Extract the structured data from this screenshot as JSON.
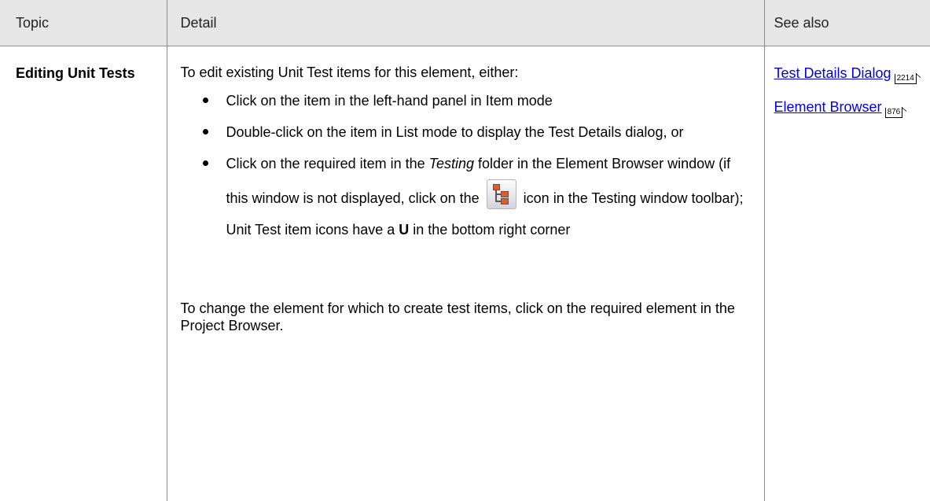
{
  "header": {
    "topic": "Topic",
    "detail": "Detail",
    "see_also": "See also"
  },
  "row": {
    "topic": "Editing Unit Tests",
    "intro": "To edit existing Unit Test items for this element, either:",
    "bullets": [
      "Click on the item in the left-hand panel in Item mode",
      "Double-click on the item in List mode to display the Test Details dialog, or"
    ],
    "bullet3": {
      "part1": "Click on the required item in the ",
      "italic": "Testing",
      "part2": " folder in the Element Browser window (if this window is not displayed, click on the ",
      "part3": " icon in the Testing window toolbar); Unit Test item icons have a ",
      "bold": "U",
      "part4": " in the bottom right corner",
      "icon": "element-browser-tree-icon"
    },
    "outro": "To change the element for which to create test items, click on the required element in the Project Browser.",
    "links": [
      {
        "label": "Test Details Dialog",
        "page": "2214"
      },
      {
        "label": "Element Browser",
        "page": "876"
      }
    ]
  },
  "colors": {
    "header_bg": "#e6e6e6",
    "link": "#0000ee",
    "border": "#8c8c8c"
  }
}
